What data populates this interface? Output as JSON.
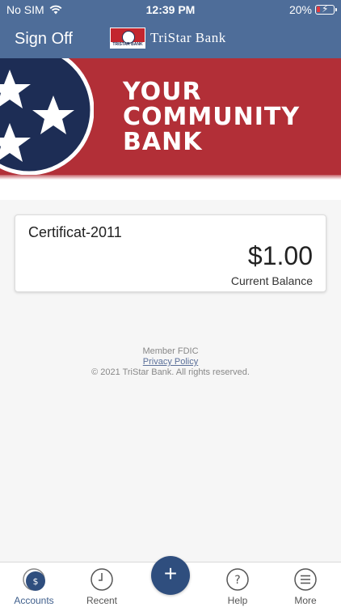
{
  "status_bar": {
    "carrier": "No SIM",
    "time": "12:39 PM",
    "battery": "20%",
    "battery_level": 0.2
  },
  "nav": {
    "sign_off": "Sign Off",
    "logo_text": "TriStar Bank",
    "logo_badge_text": "TRISTAR BANK"
  },
  "banner": {
    "line1": "YOUR",
    "line2": "COMMUNITY",
    "line3": "BANK"
  },
  "account": {
    "name": "Certificat-2011",
    "balance": "$1.00",
    "balance_label": "Current Balance"
  },
  "footer": {
    "member": "Member FDIC",
    "privacy": "Privacy Policy",
    "copyright": "© 2021 TriStar Bank. All rights reserved."
  },
  "tabs": {
    "accounts": "Accounts",
    "recent": "Recent",
    "add": "+",
    "help": "Help",
    "more": "More"
  },
  "colors": {
    "header": "#4e6d99",
    "banner_red": "#b22f37",
    "navy": "#1d2d55",
    "fab": "#2f4e7e"
  }
}
